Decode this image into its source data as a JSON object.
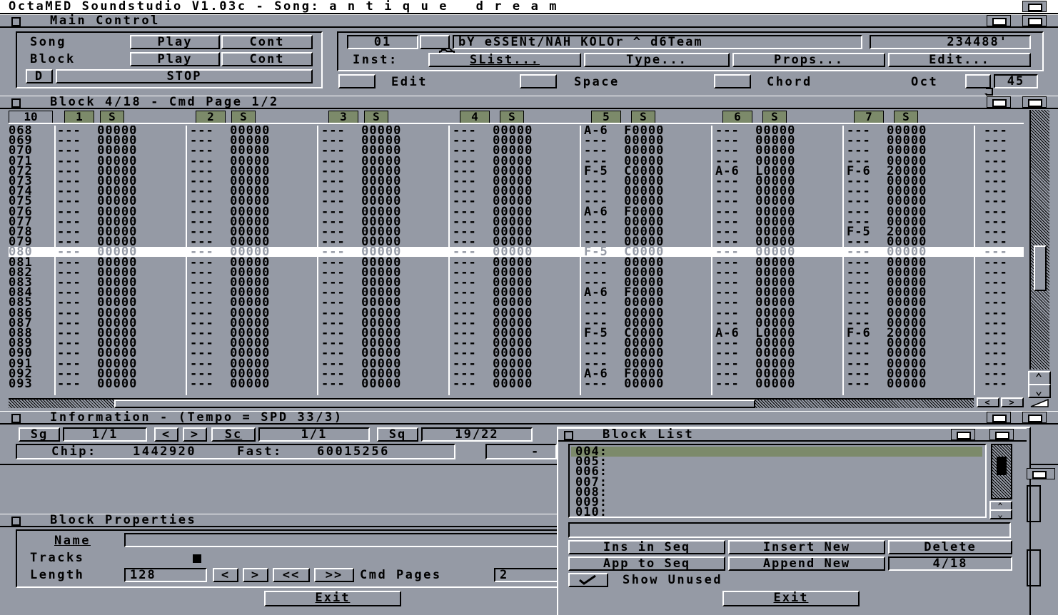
{
  "screen_title": "OctaMED Soundstudio V1.03c - Song: a n t i q u e   d r e a m",
  "main_control": {
    "title": "Main Control",
    "song_label": "Song",
    "block_label": "Block",
    "play_label": "Play",
    "cont_label": "Cont",
    "d_label": "D",
    "stop_label": "STOP",
    "inst_number": "01",
    "inst_name": "bY eSSENt/NAH KOLOr ^ d6Team",
    "inst_size": "234488'",
    "inst_label": "Inst:",
    "slist_label": "SList...",
    "type_label": "Type...",
    "props_label": "Props...",
    "edit_btn_label": "Edit...",
    "edit_label": "Edit",
    "space_label": "Space",
    "chord_label": "Chord",
    "oct_label": "Oct",
    "oct_value": "45"
  },
  "block_editor": {
    "title": "Block 4/18 - Cmd Page 1/2",
    "track_count_label": "10",
    "channels": [
      "1",
      "2",
      "3",
      "4",
      "5",
      "6",
      "7"
    ],
    "solo_label": "S",
    "current_row": "080",
    "rows": [
      {
        "n": "068",
        "c": [
          "---  00000",
          "---  00000",
          "---  00000",
          "---  00000",
          "A-6  F0000",
          "---  00000",
          "---  00000"
        ],
        "e": "---"
      },
      {
        "n": "069",
        "c": [
          "---  00000",
          "---  00000",
          "---  00000",
          "---  00000",
          "---  00000",
          "---  00000",
          "---  00000"
        ],
        "e": "---"
      },
      {
        "n": "070",
        "c": [
          "---  00000",
          "---  00000",
          "---  00000",
          "---  00000",
          "---  00000",
          "---  00000",
          "---  00000"
        ],
        "e": "---"
      },
      {
        "n": "071",
        "c": [
          "---  00000",
          "---  00000",
          "---  00000",
          "---  00000",
          "---  00000",
          "---  00000",
          "---  00000"
        ],
        "e": "---"
      },
      {
        "n": "072",
        "c": [
          "---  00000",
          "---  00000",
          "---  00000",
          "---  00000",
          "F-5  C0000",
          "A-6  L0000",
          "F-6  20000"
        ],
        "e": "---"
      },
      {
        "n": "073",
        "c": [
          "---  00000",
          "---  00000",
          "---  00000",
          "---  00000",
          "---  00000",
          "---  00000",
          "---  00000"
        ],
        "e": "---"
      },
      {
        "n": "074",
        "c": [
          "---  00000",
          "---  00000",
          "---  00000",
          "---  00000",
          "---  00000",
          "---  00000",
          "---  00000"
        ],
        "e": "---"
      },
      {
        "n": "075",
        "c": [
          "---  00000",
          "---  00000",
          "---  00000",
          "---  00000",
          "---  00000",
          "---  00000",
          "---  00000"
        ],
        "e": "---"
      },
      {
        "n": "076",
        "c": [
          "---  00000",
          "---  00000",
          "---  00000",
          "---  00000",
          "A-6  F0000",
          "---  00000",
          "---  00000"
        ],
        "e": "---"
      },
      {
        "n": "077",
        "c": [
          "---  00000",
          "---  00000",
          "---  00000",
          "---  00000",
          "---  00000",
          "---  00000",
          "---  00000"
        ],
        "e": "---"
      },
      {
        "n": "078",
        "c": [
          "---  00000",
          "---  00000",
          "---  00000",
          "---  00000",
          "---  00000",
          "---  00000",
          "F-5  20000"
        ],
        "e": "---"
      },
      {
        "n": "079",
        "c": [
          "---  00000",
          "---  00000",
          "---  00000",
          "---  00000",
          "---  00000",
          "---  00000",
          "---  00000"
        ],
        "e": "---"
      },
      {
        "n": "080",
        "c": [
          "---  00000",
          "---  00000",
          "---  00000",
          "---  00000",
          "F-5  C0000",
          "---  00000",
          "---  00000"
        ],
        "e": "---"
      },
      {
        "n": "081",
        "c": [
          "---  00000",
          "---  00000",
          "---  00000",
          "---  00000",
          "---  00000",
          "---  00000",
          "---  00000"
        ],
        "e": "---"
      },
      {
        "n": "082",
        "c": [
          "---  00000",
          "---  00000",
          "---  00000",
          "---  00000",
          "---  00000",
          "---  00000",
          "---  00000"
        ],
        "e": "---"
      },
      {
        "n": "083",
        "c": [
          "---  00000",
          "---  00000",
          "---  00000",
          "---  00000",
          "---  00000",
          "---  00000",
          "---  00000"
        ],
        "e": "---"
      },
      {
        "n": "084",
        "c": [
          "---  00000",
          "---  00000",
          "---  00000",
          "---  00000",
          "A-6  F0000",
          "---  00000",
          "---  00000"
        ],
        "e": "---"
      },
      {
        "n": "085",
        "c": [
          "---  00000",
          "---  00000",
          "---  00000",
          "---  00000",
          "---  00000",
          "---  00000",
          "---  00000"
        ],
        "e": "---"
      },
      {
        "n": "086",
        "c": [
          "---  00000",
          "---  00000",
          "---  00000",
          "---  00000",
          "---  00000",
          "---  00000",
          "---  00000"
        ],
        "e": "---"
      },
      {
        "n": "087",
        "c": [
          "---  00000",
          "---  00000",
          "---  00000",
          "---  00000",
          "---  00000",
          "---  00000",
          "---  00000"
        ],
        "e": "---"
      },
      {
        "n": "088",
        "c": [
          "---  00000",
          "---  00000",
          "---  00000",
          "---  00000",
          "F-5  C0000",
          "A-6  L0000",
          "F-6  20000"
        ],
        "e": "---"
      },
      {
        "n": "089",
        "c": [
          "---  00000",
          "---  00000",
          "---  00000",
          "---  00000",
          "---  00000",
          "---  00000",
          "---  00000"
        ],
        "e": "---"
      },
      {
        "n": "090",
        "c": [
          "---  00000",
          "---  00000",
          "---  00000",
          "---  00000",
          "---  00000",
          "---  00000",
          "---  00000"
        ],
        "e": "---"
      },
      {
        "n": "091",
        "c": [
          "---  00000",
          "---  00000",
          "---  00000",
          "---  00000",
          "---  00000",
          "---  00000",
          "---  00000"
        ],
        "e": "---"
      },
      {
        "n": "092",
        "c": [
          "---  00000",
          "---  00000",
          "---  00000",
          "---  00000",
          "A-6  F0000",
          "---  00000",
          "---  00000"
        ],
        "e": "---"
      },
      {
        "n": "093",
        "c": [
          "---  00000",
          "---  00000",
          "---  00000",
          "---  00000",
          "---  00000",
          "---  00000",
          "---  00000"
        ],
        "e": "---"
      }
    ]
  },
  "information": {
    "title": "Information - (Tempo = SPD 33/3)",
    "sg1_label": "Sg",
    "sg1_value": "1/1",
    "prev_label": "<",
    "next_label": ">",
    "sg2_label": "Sc",
    "sg2_value": "1/1",
    "sg3_label": "Sq",
    "sg3_value": "19/22",
    "chip_label": "Chip:",
    "chip_value": "1442920",
    "fast_label": "Fast:",
    "fast_value": "60015256",
    "dash": "-"
  },
  "block_properties": {
    "title": "Block Properties",
    "name_label": "Name",
    "tracks_label": "Tracks",
    "length_label": "Length",
    "length_value": "128",
    "btn_lt": "<",
    "btn_gt": ">",
    "btn_llt": "<<",
    "btn_ggt": ">>",
    "cmd_pages_label": "Cmd Pages",
    "cmd_pages_value": "2",
    "exit_label": "Exit"
  },
  "block_list": {
    "title": "Block List",
    "items": [
      "004:",
      "005:",
      "006:",
      "007:",
      "008:",
      "009:",
      "010:"
    ],
    "ins_in_seq": "Ins in Seq",
    "insert_new": "Insert New",
    "delete": "Delete",
    "app_to_seq": "App to Seq",
    "append_new": "Append New",
    "position": "4/18",
    "show_unused": "Show Unused",
    "exit_label": "Exit"
  }
}
